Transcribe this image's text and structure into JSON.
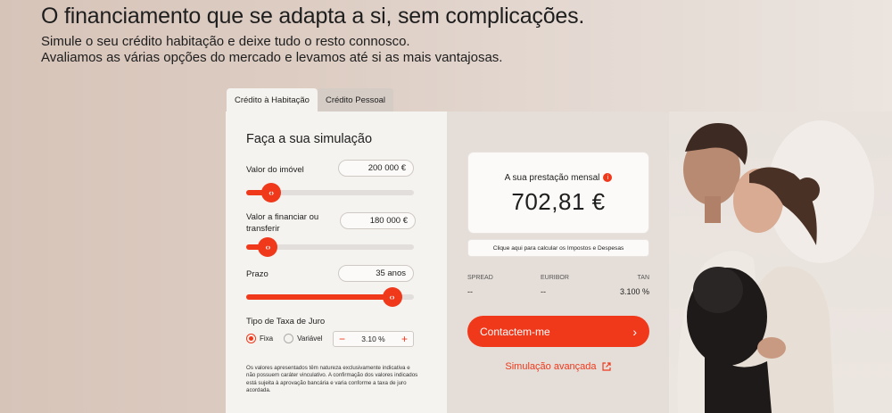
{
  "hero": {
    "headline": "O financiamento que se adapta a si, sem complicações.",
    "sub_line1": "Simule o seu crédito habitação e deixe tudo o resto connosco.",
    "sub_line2": "Avaliamos as várias opções do mercado e levamos até si as mais vantajosas."
  },
  "tabs": [
    {
      "label": "Crédito à Habitação",
      "active": true
    },
    {
      "label": "Crédito Pessoal",
      "active": false
    }
  ],
  "simulator": {
    "title": "Faça a sua simulação",
    "property_value": {
      "label": "Valor do imóvel",
      "value": "200 000 €",
      "slider_fraction": 0.15
    },
    "financing": {
      "label": "Valor a financiar ou transferir",
      "value": "180 000 €",
      "slider_fraction": 0.13
    },
    "term": {
      "label": "Prazo",
      "value": "35 anos",
      "slider_fraction": 0.87
    },
    "rate_type": {
      "label": "Tipo de Taxa de Juro",
      "option_fixed": "Fixa",
      "option_variable": "Variável",
      "selected": "Fixa",
      "rate_value": "3.10 %",
      "minus": "−",
      "plus": "+"
    },
    "disclaimer": "Os valores apresentados têm natureza exclusivamente indicativa e não possuem caráter vinculativo. A confirmação dos valores indicados está sujeita à aprovação bancária e varia conforme a taxa de juro acordada."
  },
  "result": {
    "label": "A sua prestação mensal",
    "info": "i",
    "value": "702,81 €",
    "taxes_link": "Clique aqui para calcular os Impostos e Despesas",
    "spread_label": "SPREAD",
    "spread_value": "--",
    "euribor_label": "EURIBOR",
    "euribor_value": "--",
    "tan_label": "TAN",
    "tan_value": "3.100 %",
    "contact_button": "Contactem-me",
    "advanced_link": "Simulação avançada"
  },
  "colors": {
    "accent": "#f0381b",
    "panel_light": "#f5f3ef",
    "panel_dark": "#e5ded8"
  },
  "icons": {
    "slider_thumb": "chevrons-left-right-icon",
    "info": "info-icon",
    "contact_arrow": "chevron-right-icon",
    "external_link": "external-link-icon"
  }
}
